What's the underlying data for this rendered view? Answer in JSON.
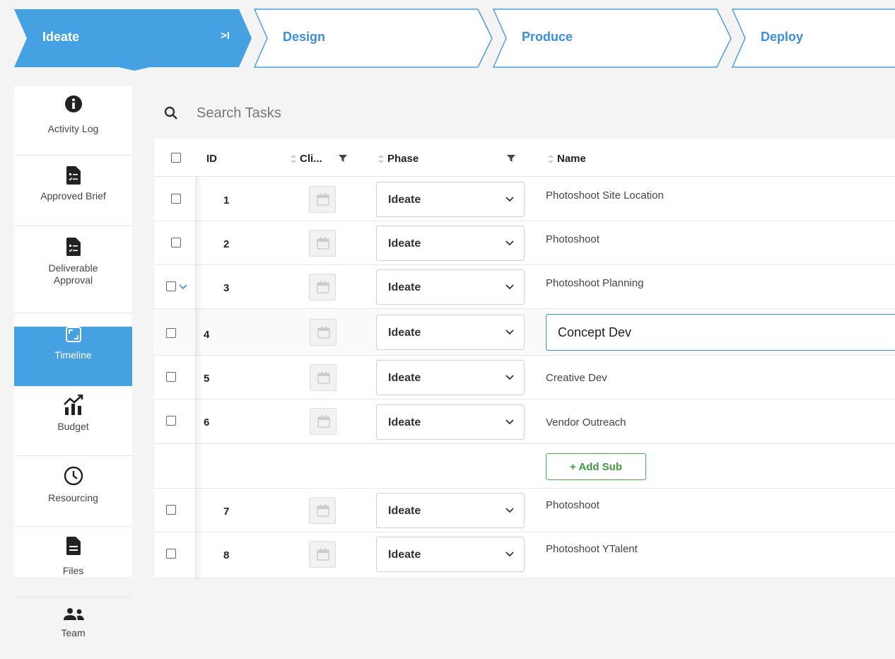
{
  "phases": [
    {
      "label": "Ideate",
      "active": true
    },
    {
      "label": "Design",
      "active": false
    },
    {
      "label": "Produce",
      "active": false
    },
    {
      "label": "Deploy",
      "active": false
    }
  ],
  "phase_collapse_glyph": ">I",
  "sidebar": {
    "items": [
      {
        "label": "Activity Log",
        "icon": "info-icon"
      },
      {
        "label": "Approved Brief",
        "icon": "brief-icon"
      },
      {
        "label": "Deliverable Approval",
        "icon": "brief-icon"
      },
      {
        "label": "Timeline",
        "icon": "timeline-icon",
        "active": true
      },
      {
        "label": "Budget",
        "icon": "budget-icon"
      },
      {
        "label": "Resourcing",
        "icon": "clock-icon"
      },
      {
        "label": "Files",
        "icon": "file-icon"
      },
      {
        "label": "Team",
        "icon": "team-icon"
      }
    ]
  },
  "search": {
    "placeholder": "Search Tasks",
    "value": ""
  },
  "grid": {
    "columns": {
      "id": "ID",
      "client": "Cli...",
      "phase": "Phase",
      "name": "Name"
    },
    "rows": [
      {
        "id": "1",
        "phase": "Ideate",
        "name": "Photoshoot Site Location"
      },
      {
        "id": "2",
        "phase": "Ideate",
        "name": "Photoshoot"
      },
      {
        "id": "3",
        "phase": "Ideate",
        "name": "Photoshoot Planning"
      },
      {
        "id": "4",
        "phase": "Ideate",
        "name": "Concept Dev"
      },
      {
        "id": "5",
        "phase": "Ideate",
        "name": "Creative Dev"
      },
      {
        "id": "6",
        "phase": "Ideate",
        "name": "Vendor Outreach"
      },
      {
        "id": "7",
        "phase": "Ideate",
        "name": "Photoshoot"
      },
      {
        "id": "8",
        "phase": "Ideate",
        "name": "Photoshoot YTalent"
      }
    ],
    "add_sub_label": "+ Add Sub"
  },
  "colors": {
    "accent": "#45a1e2",
    "phase_outline": "#3d8fd6",
    "add_sub": "#4cae4c"
  }
}
